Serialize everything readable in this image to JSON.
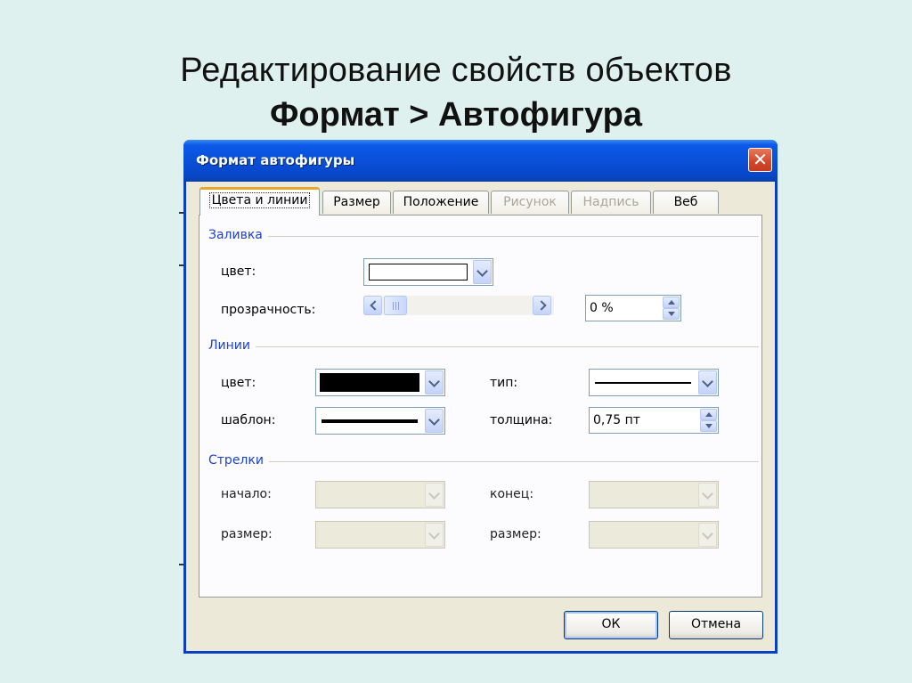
{
  "slide": {
    "title_line1": "Редактирование свойств объектов",
    "title_line2": "Формат > Автофигура"
  },
  "dialog": {
    "title": "Формат автофигуры",
    "close_glyph": "✕",
    "tabs": [
      {
        "label": "Цвета и линии",
        "state": "active"
      },
      {
        "label": "Размер",
        "state": "enabled"
      },
      {
        "label": "Положение",
        "state": "enabled"
      },
      {
        "label": "Рисунок",
        "state": "disabled"
      },
      {
        "label": "Надпись",
        "state": "disabled"
      },
      {
        "label": "Веб",
        "state": "enabled"
      }
    ],
    "fill": {
      "group_label": "Заливка",
      "color_label": "цвет:",
      "color_value": "#ffffff",
      "transparency_label": "прозрачность:",
      "transparency_value": "0 %",
      "transparency_slider_percent": 0
    },
    "lines": {
      "group_label": "Линии",
      "color_label": "цвет:",
      "color_value": "#000000",
      "pattern_label": "шаблон:",
      "type_label": "тип:",
      "weight_label": "толщина:",
      "weight_value": "0,75 пт"
    },
    "arrows": {
      "group_label": "Стрелки",
      "start_label": "начало:",
      "start_size_label": "размер:",
      "end_label": "конец:",
      "end_size_label": "размер:",
      "state": "disabled"
    },
    "buttons": {
      "ok_label": "ОК",
      "cancel_label": "Отмена"
    }
  },
  "colors": {
    "slide_background": "#dff1ef",
    "titlebar_blue": "#0a4fd8",
    "group_label_blue": "#1d41d1",
    "close_red": "#d4462a"
  }
}
